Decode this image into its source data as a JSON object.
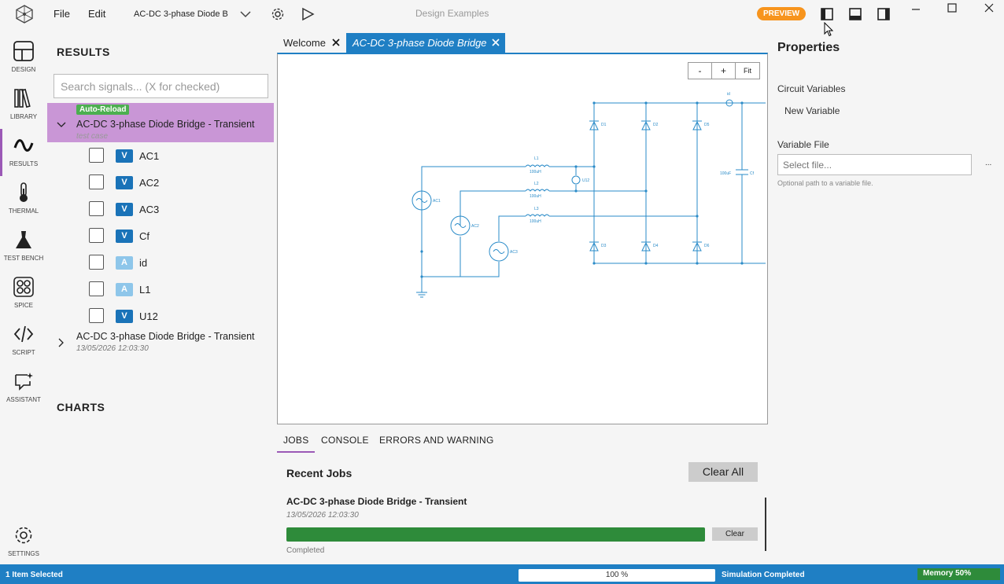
{
  "titlebar": {
    "menu_file": "File",
    "menu_edit": "Edit",
    "project_name": "AC-DC 3-phase Diode Bri",
    "center_title": "Design Examples",
    "preview_badge": "PREVIEW",
    "preview_color": "#f7941d"
  },
  "activity": [
    {
      "label": "DESIGN",
      "icon": "design-icon"
    },
    {
      "label": "LIBRARY",
      "icon": "library-icon"
    },
    {
      "label": "RESULTS",
      "icon": "results-icon"
    },
    {
      "label": "THERMAL",
      "icon": "thermal-icon"
    },
    {
      "label": "TEST BENCH",
      "icon": "test-bench-icon"
    },
    {
      "label": "SPICE",
      "icon": "spice-icon"
    },
    {
      "label": "SCRIPT",
      "icon": "script-icon"
    },
    {
      "label": "ASSISTANT",
      "icon": "assistant-icon"
    },
    {
      "label": "SETTINGS",
      "icon": "settings-icon"
    }
  ],
  "results": {
    "title": "RESULTS",
    "search_placeholder": "Search signals... (X for checked)",
    "run1": {
      "badge": "Auto-Reload",
      "title": "AC-DC 3-phase Diode Bridge - Transient",
      "subtitle": "test case"
    },
    "signals": [
      {
        "type": "V",
        "name": "AC1"
      },
      {
        "type": "V",
        "name": "AC2"
      },
      {
        "type": "V",
        "name": "AC3"
      },
      {
        "type": "V",
        "name": "Cf"
      },
      {
        "type": "A",
        "name": "id"
      },
      {
        "type": "A",
        "name": "L1"
      },
      {
        "type": "V",
        "name": "U12"
      }
    ],
    "run2": {
      "title": "AC-DC 3-phase Diode Bridge - Transient",
      "subtitle": "13/05/2026 12:03:30"
    },
    "charts_title": "CHARTS"
  },
  "tabs": [
    {
      "label": "Welcome",
      "active": false
    },
    {
      "label": "AC-DC 3-phase Diode Bridge",
      "active": true
    }
  ],
  "zoom": {
    "minus": "-",
    "plus": "+",
    "fit": "Fit"
  },
  "schematic": {
    "L1": "L1",
    "L2": "L2",
    "L3": "L3",
    "L_value": "100uH",
    "AC1": "AC1",
    "AC2": "AC2",
    "AC3": "AC3",
    "D1": "D1",
    "D2": "D2",
    "D3": "D3",
    "D4": "D4",
    "D5": "D5",
    "D6": "D6",
    "Cf": "Cf",
    "Cf_value": "100uF",
    "id": "id",
    "U12": "U12"
  },
  "bottom": {
    "tabs": [
      "JOBS",
      "CONSOLE",
      "ERRORS AND WARNING"
    ],
    "recent_jobs": "Recent Jobs",
    "clear_all": "Clear All",
    "job_title": "AC-DC 3-phase Diode Bridge - Transient",
    "job_time": "13/05/2026 12:03:30",
    "job_progress": 1.0,
    "job_clear": "Clear",
    "job_status": "Completed"
  },
  "props": {
    "title": "Properties",
    "circuit_variables": "Circuit Variables",
    "new_variable": "New Variable",
    "variable_file": "Variable File",
    "file_placeholder": "Select file...",
    "more": "...",
    "hint": "Optional path to a variable file."
  },
  "status": {
    "selected": "1 Item Selected",
    "progress_text": "100 %",
    "progress": 1.0,
    "sim_status": "Simulation Completed",
    "memory": "Memory 50%",
    "memory_fraction": 0.5
  },
  "colors": {
    "accent": "#1f7fc4",
    "success": "#2e8b3a",
    "selected_run": "#c996d6",
    "tag_v": "#1a73b8",
    "tag_a": "#8ec6ea"
  }
}
